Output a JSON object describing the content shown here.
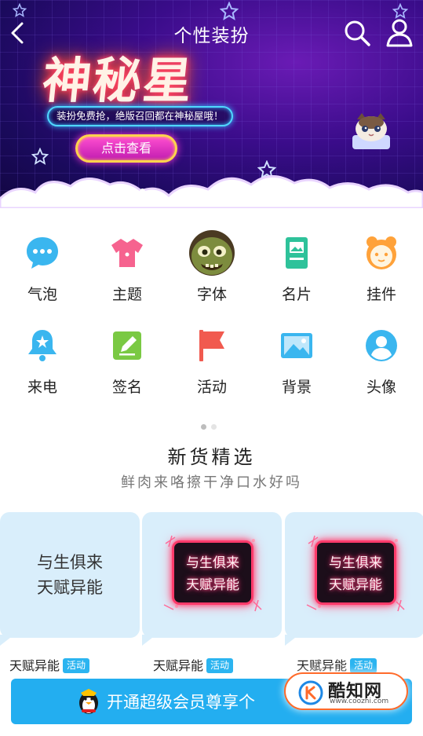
{
  "header": {
    "title": "个性装扮"
  },
  "banner": {
    "headline": "神秘星",
    "subtitle": "装扮免费抢，绝版召回都在神秘屋哦！",
    "button_label": "点击查看",
    "indicator_count": 1
  },
  "categories": [
    {
      "label": "气泡",
      "icon": "chat-bubble-icon",
      "color": "#3ab6ef"
    },
    {
      "label": "主题",
      "icon": "shirt-icon",
      "color": "#f6638f"
    },
    {
      "label": "字体",
      "icon": "font-avatar-icon",
      "color": "#6b7a3a"
    },
    {
      "label": "名片",
      "icon": "card-icon",
      "color": "#2ec29a"
    },
    {
      "label": "挂件",
      "icon": "pendant-icon",
      "color": "#ffa23a"
    },
    {
      "label": "来电",
      "icon": "bell-icon",
      "color": "#3ab6ef"
    },
    {
      "label": "签名",
      "icon": "signature-icon",
      "color": "#7ac943"
    },
    {
      "label": "活动",
      "icon": "flag-icon",
      "color": "#f15a4f"
    },
    {
      "label": "背景",
      "icon": "image-icon",
      "color": "#3ab6ef"
    },
    {
      "label": "头像",
      "icon": "avatar-icon",
      "color": "#3ab6ef"
    }
  ],
  "new_arrivals": {
    "title": "新货精选",
    "subtitle": "鲜肉来咯擦干净口水好吗",
    "items": [
      {
        "line1": "与生俱来",
        "line2": "天赋异能",
        "name": "天赋异能",
        "tag": "活动"
      },
      {
        "line1": "与生俱来",
        "line2": "天赋异能",
        "name": "天赋异能",
        "tag": "活动"
      },
      {
        "line1": "与生俱来",
        "line2": "天赋异能",
        "name": "天赋异能",
        "tag": "活动"
      }
    ]
  },
  "cta": {
    "label": "开通超级会员尊享个"
  },
  "watermark": {
    "name": "酷知网",
    "url": "www.coozhi.com"
  },
  "colors": {
    "accent": "#23aef0",
    "tag": "#2bb4f0"
  }
}
